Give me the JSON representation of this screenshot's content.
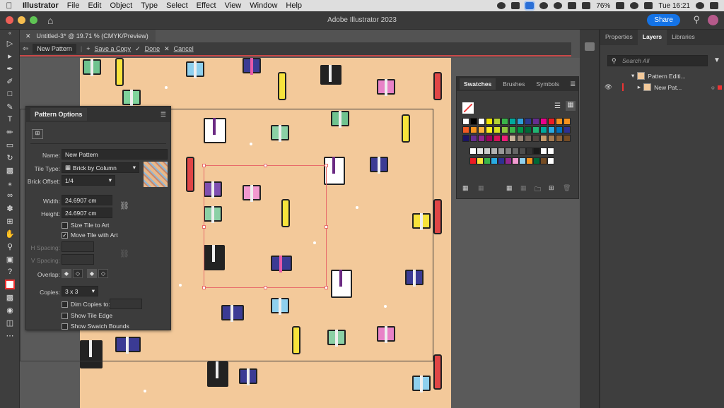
{
  "menubar": {
    "app_name": "Illustrator",
    "items": [
      "File",
      "Edit",
      "Object",
      "Type",
      "Select",
      "Effect",
      "View",
      "Window",
      "Help"
    ],
    "battery": "76%",
    "clock": "Tue 16:21"
  },
  "app": {
    "title": "Adobe Illustrator 2023",
    "share_label": "Share"
  },
  "document": {
    "tab_title": "Untitled-3* @ 19.71 % (CMYK/Preview)",
    "pattern_name_pill": "New Pattern",
    "save_copy": "Save a Copy",
    "done": "Done",
    "cancel": "Cancel"
  },
  "pattern_options": {
    "title": "Pattern Options",
    "name_label": "Name:",
    "name_value": "New Pattern",
    "tile_type_label": "Tile Type:",
    "tile_type_value": "Brick by Column",
    "brick_offset_label": "Brick Offset:",
    "brick_offset_value": "1/4",
    "width_label": "Width:",
    "width_value": "24.6907 cm",
    "height_label": "Height:",
    "height_value": "24.6907 cm",
    "size_tile_to_art": "Size Tile to Art",
    "size_tile_to_art_checked": false,
    "move_tile_with_art": "Move Tile with Art",
    "move_tile_with_art_checked": true,
    "h_spacing_label": "H Spacing:",
    "v_spacing_label": "V Spacing:",
    "overlap_label": "Overlap:",
    "copies_label": "Copies:",
    "copies_value": "3 x 3",
    "dim_copies": "Dim Copies to:",
    "show_tile_edge": "Show Tile Edge",
    "show_swatch_bounds": "Show Swatch Bounds"
  },
  "swatches": {
    "tabs": [
      "Swatches",
      "Brushes",
      "Symbols"
    ],
    "active_tab": "Swatches",
    "colors_row1": [
      "#ffffff",
      "#000000",
      "#ffffff",
      "#f2e600",
      "#b4d335",
      "#3ab54a",
      "#00a99d",
      "#2e9fd9",
      "#2b3990",
      "#662d91",
      "#ec008c",
      "#ed1c24",
      "#f7941d",
      "#f7931e"
    ],
    "colors_row2": [
      "#f15a24",
      "#f7941d",
      "#fbb03b",
      "#fcee21",
      "#d9e021",
      "#8cc63f",
      "#39b54a",
      "#009245",
      "#006837",
      "#22b573",
      "#00a99d",
      "#29abe2",
      "#0071bc",
      "#2e3192"
    ],
    "colors_row3": [
      "#1b1464",
      "#662d91",
      "#93278f",
      "#9e005d",
      "#d4145a",
      "#ed1e79",
      "#c7b299",
      "#998675",
      "#736357",
      "#534741",
      "#c69c6d",
      "#a67c52",
      "#8c6239",
      "#754c24"
    ],
    "grays": [
      "#ffffff",
      "#e6e6e6",
      "#cccccc",
      "#b3b3b3",
      "#999999",
      "#808080",
      "#666666",
      "#4d4d4d",
      "#333333",
      "#1a1a1a",
      "#ffffff",
      "#ffffff"
    ]
  },
  "right_panel": {
    "tabs": [
      "Properties",
      "Layers",
      "Libraries"
    ],
    "active_tab": "Layers",
    "search_placeholder": "Search All",
    "layer1": "Pattern Editi...",
    "layer2": "New Pat..."
  }
}
